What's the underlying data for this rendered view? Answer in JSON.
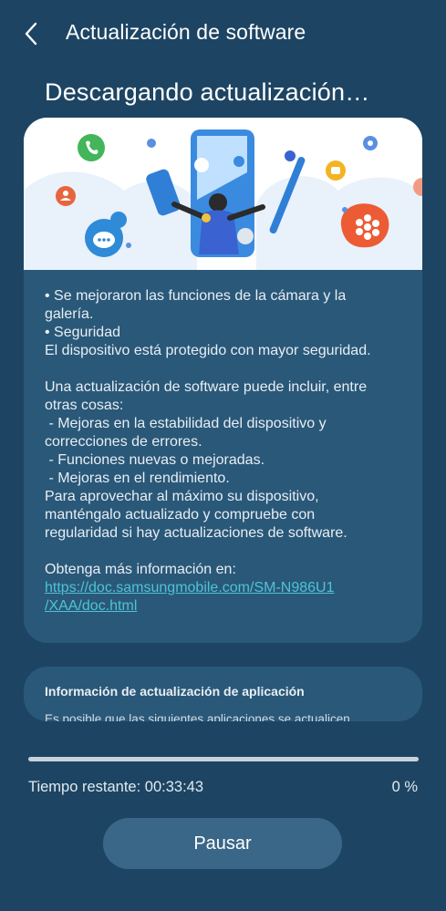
{
  "header": {
    "title": "Actualización de software",
    "back_icon": "chevron-left-icon"
  },
  "page_heading": "Descargando actualización…",
  "release_notes": {
    "illustration": "software-update-illustration",
    "lines": [
      "• Se mejoraron las funciones de la cámara y la",
      "galería.",
      "• Seguridad",
      "El dispositivo está protegido con mayor seguridad.",
      "",
      "Una actualización de software puede incluir, entre",
      "otras cosas:",
      " - Mejoras en la estabilidad del dispositivo y",
      "correcciones de errores.",
      " - Funciones nuevas o mejoradas.",
      " - Mejoras en el rendimiento.",
      "Para aprovechar al máximo su dispositivo,",
      "manténgalo actualizado y compruebe con",
      "regularidad si hay actualizaciones de software.",
      "",
      "Obtenga más información en:"
    ],
    "link_lines": [
      "https://doc.samsungmobile.com/SM-N986U1",
      "/XAA/doc.html"
    ]
  },
  "app_update_info": {
    "title": "Información de actualización de aplicación",
    "body": "Es posible que las siguientes aplicaciones se actualicen"
  },
  "progress": {
    "fraction": 0,
    "remaining_text": "Tiempo restante: 00:33:43",
    "percent_text": "0 %"
  },
  "pause_button": {
    "label": "Pausar"
  },
  "colors": {
    "background": "#1d4563",
    "card": "#2a5878",
    "link": "#4ec3d6",
    "button": "#3a6788"
  }
}
